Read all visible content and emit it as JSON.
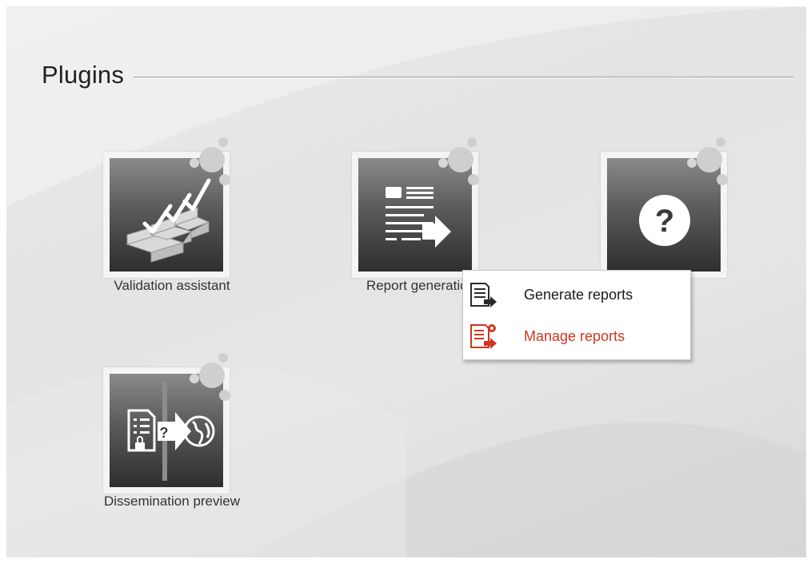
{
  "section": {
    "title": "Plugins"
  },
  "plugins": [
    {
      "label": "Validation assistant",
      "icon": "validation-checkmarks-icon"
    },
    {
      "label": "Report generation",
      "icon": "report-document-arrow-icon"
    },
    {
      "label": "",
      "icon": "question-mark-icon"
    },
    {
      "label": "Dissemination preview",
      "icon": "dissemination-preview-icon"
    }
  ],
  "context_menu": {
    "items": [
      {
        "label": "Generate reports",
        "icon": "generate-report-icon",
        "color": "#1a1a1a"
      },
      {
        "label": "Manage reports",
        "icon": "manage-report-icon",
        "color": "#d0351f"
      }
    ]
  },
  "colors": {
    "accent_red": "#d0351f",
    "tile_dark": "#2e2e2e",
    "dot_gray": "#c9c9c9"
  }
}
